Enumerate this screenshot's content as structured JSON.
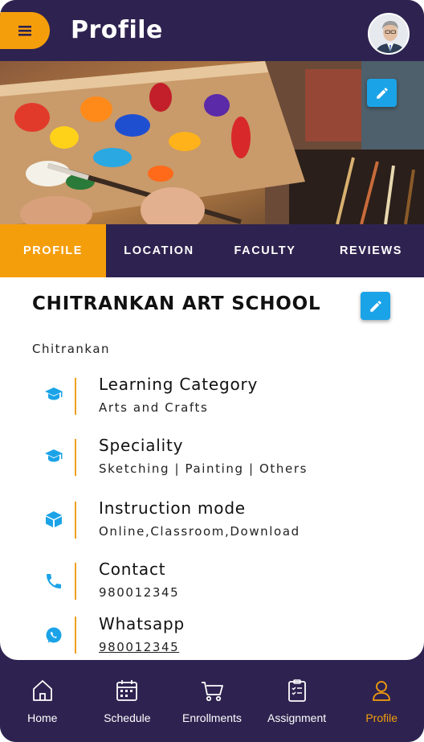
{
  "header": {
    "title": "Profile",
    "menu_icon": "hamburger-icon",
    "avatar_icon": "user-avatar"
  },
  "banner": {
    "edit_icon": "pencil-icon"
  },
  "tabs": [
    {
      "label": "PROFILE",
      "active": true
    },
    {
      "label": "LOCATION",
      "active": false
    },
    {
      "label": "FACULTY",
      "active": false
    },
    {
      "label": "REVIEWS",
      "active": false
    }
  ],
  "school": {
    "name": "CHITRANKAN ART SCHOOL",
    "subtitle": "Chitrankan"
  },
  "info": [
    {
      "icon": "graduation-cap-icon",
      "label": "Learning Category",
      "value": "Arts and Crafts"
    },
    {
      "icon": "graduation-cap-icon",
      "label": "Speciality",
      "value": "Sketching | Painting | Others"
    },
    {
      "icon": "cube-icon",
      "label": "Instruction mode",
      "value": "Online,Classroom,Download"
    },
    {
      "icon": "phone-icon",
      "label": "Contact",
      "value": "980012345"
    },
    {
      "icon": "whatsapp-icon",
      "label": "Whatsapp",
      "value": "980012345"
    }
  ],
  "bottom_nav": [
    {
      "label": "Home",
      "icon": "home-icon",
      "active": false
    },
    {
      "label": "Schedule",
      "icon": "calendar-icon",
      "active": false
    },
    {
      "label": "Enrollments",
      "icon": "cart-icon",
      "active": false
    },
    {
      "label": "Assignment",
      "icon": "clipboard-icon",
      "active": false
    },
    {
      "label": "Profile",
      "icon": "user-icon",
      "active": true
    }
  ],
  "colors": {
    "primary": "#2e2350",
    "accent": "#f59e0b",
    "icon_blue": "#1ba3e8"
  }
}
